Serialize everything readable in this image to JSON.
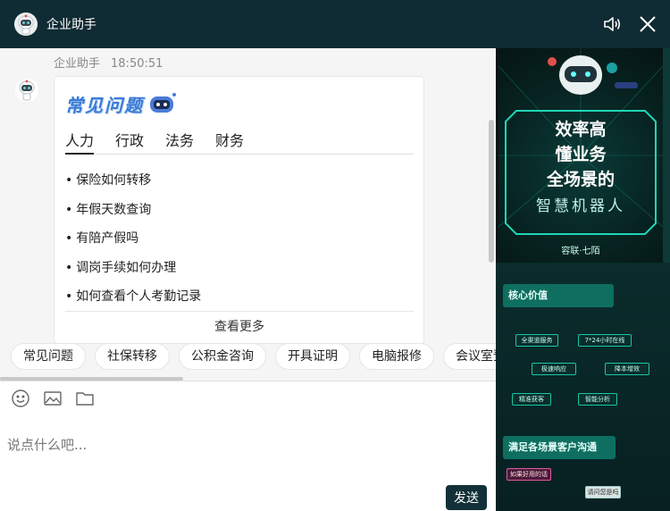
{
  "header": {
    "title": "企业助手"
  },
  "message": {
    "sender": "企业助手",
    "time": "18:50:51",
    "card": {
      "heading": "常见问题",
      "tabs": [
        "人力",
        "行政",
        "法务",
        "财务"
      ],
      "active_tab": "人力",
      "questions": [
        "保险如何转移",
        "年假天数查询",
        "有陪产假吗",
        "调岗手续如何办理",
        "如何查看个人考勤记录"
      ],
      "more_label": "查看更多"
    }
  },
  "quick_replies": [
    "常见问题",
    "社保转移",
    "公积金咨询",
    "开具证明",
    "电脑报修",
    "会议室预定"
  ],
  "composer": {
    "placeholder": "说点什么吧...",
    "send_label": "发送"
  },
  "ad": {
    "headline": [
      "效率高",
      "懂业务",
      "全场景的"
    ],
    "subline": "智慧机器人",
    "brand": "容联·七陌",
    "section1": "核心价值",
    "features": [
      "全渠道服务",
      "7*24小时在线",
      "极速响应",
      "降本增效",
      "精准获客",
      "智能分析"
    ],
    "section2": "满足各场景客户沟通",
    "tag": "如果好用的话",
    "bubble": "请问您是吗"
  },
  "colors": {
    "header_bg": "#0f2b33",
    "send_bg": "#123038",
    "accent": "#3a7bd5"
  }
}
